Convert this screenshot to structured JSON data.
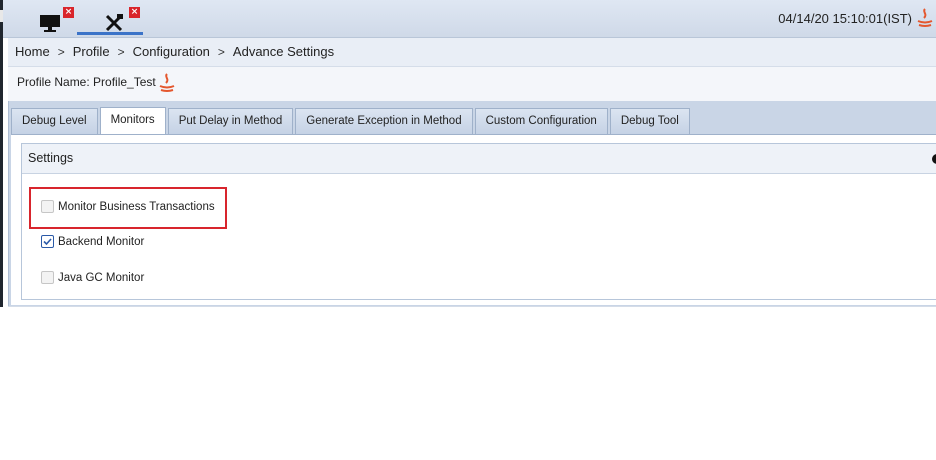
{
  "topbar": {
    "datetime": "04/14/20 15:10:01(IST)",
    "tabs": [
      {
        "icon": "monitor-icon",
        "close": "×"
      },
      {
        "icon": "tools-icon",
        "close": "×"
      }
    ]
  },
  "breadcrumb": {
    "items": [
      "Home",
      "Profile",
      "Configuration",
      "Advance Settings"
    ],
    "separator": ">"
  },
  "profile": {
    "label": "Profile Name: Profile_Test"
  },
  "tabs": [
    {
      "label": "Debug Level",
      "active": false
    },
    {
      "label": "Monitors",
      "active": true
    },
    {
      "label": "Put Delay in Method",
      "active": false
    },
    {
      "label": "Generate Exception in Method",
      "active": false
    },
    {
      "label": "Custom Configuration",
      "active": false
    },
    {
      "label": "Debug Tool",
      "active": false
    }
  ],
  "settings": {
    "title": "Settings",
    "options": [
      {
        "label": "Monitor Business Transactions",
        "checked": false,
        "highlighted": true
      },
      {
        "label": "Backend Monitor",
        "checked": true,
        "highlighted": false
      },
      {
        "label": "Java GC Monitor",
        "checked": false,
        "highlighted": false
      }
    ]
  },
  "colors": {
    "highlight_border": "#d8252d",
    "close_badge": "#d9252b",
    "active_tab_underline": "#3b73c8"
  }
}
